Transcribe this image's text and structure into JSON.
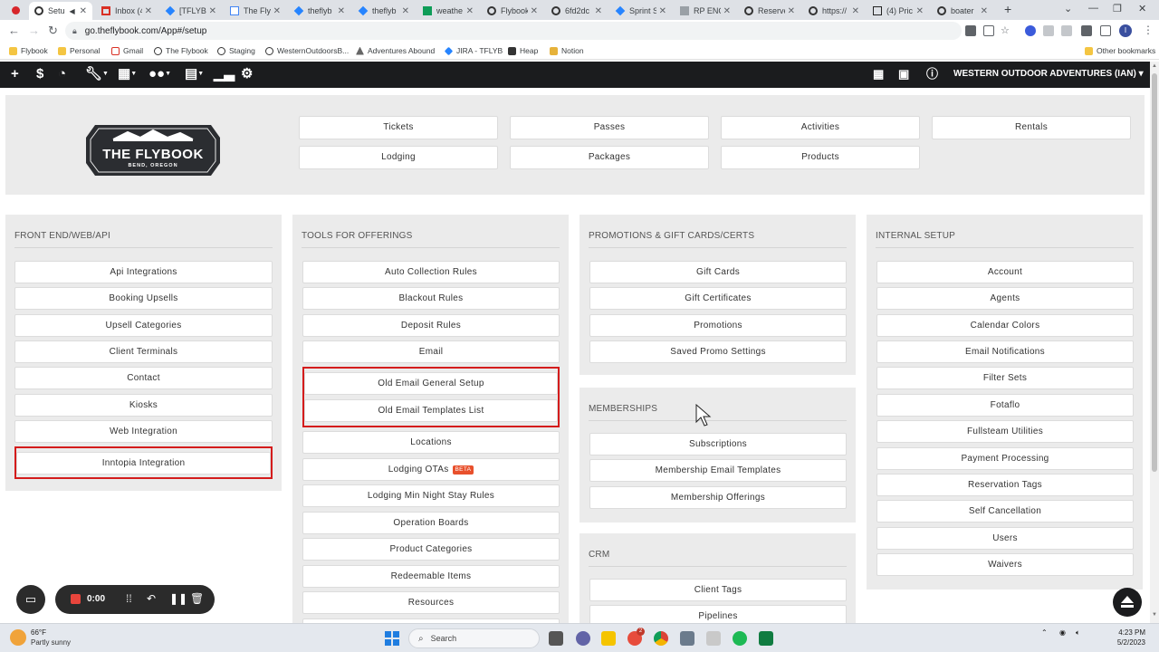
{
  "browser": {
    "tabs": [
      {
        "title": "Setu",
        "active": true
      },
      {
        "title": "Inbox (4"
      },
      {
        "title": "[TFLYB-"
      },
      {
        "title": "The Flyb"
      },
      {
        "title": "theflyb"
      },
      {
        "title": "theflyb"
      },
      {
        "title": "weathe"
      },
      {
        "title": "Flybook"
      },
      {
        "title": "6fd2dc"
      },
      {
        "title": "Sprint S"
      },
      {
        "title": "RP ENG"
      },
      {
        "title": "Reserve"
      },
      {
        "title": "https://"
      },
      {
        "title": "(4) Pric"
      },
      {
        "title": "boater"
      }
    ],
    "url": "go.theflybook.com/App#/setup",
    "bookmarks": [
      "Flybook",
      "Personal",
      "Gmail",
      "The Flybook",
      "Staging",
      "WesternOutdoorsB...",
      "Adventures Abound",
      "JIRA - TFLYB",
      "Heap",
      "Notion"
    ],
    "other_bookmarks": "Other bookmarks",
    "profile_initial": "I"
  },
  "app": {
    "account": "WESTERN OUTDOOR ADVENTURES (IAN)",
    "logo": {
      "name": "THE FLYBOOK",
      "location": "BEND, OREGON"
    },
    "offerings": [
      "Tickets",
      "Passes",
      "Activities",
      "Rentals",
      "Lodging",
      "Packages",
      "Products"
    ],
    "sections": {
      "front_end": {
        "title": "FRONT END/WEB/API",
        "items": [
          "Api Integrations",
          "Booking Upsells",
          "Upsell Categories",
          "Client Terminals",
          "Contact",
          "Kiosks",
          "Web Integration",
          "Inntopia Integration"
        ]
      },
      "tools": {
        "title": "TOOLS FOR OFFERINGS",
        "items": [
          "Auto Collection Rules",
          "Blackout Rules",
          "Deposit Rules",
          "Email",
          "Old Email General Setup",
          "Old Email Templates List",
          "Locations",
          "Lodging OTAs",
          "Lodging Min Night Stay Rules",
          "Operation Boards",
          "Product Categories",
          "Redeemable Items",
          "Resources"
        ],
        "beta_label": "BETA"
      },
      "promotions": {
        "title": "PROMOTIONS & GIFT CARDS/CERTS",
        "items": [
          "Gift Cards",
          "Gift Certificates",
          "Promotions",
          "Saved Promo Settings"
        ]
      },
      "memberships": {
        "title": "MEMBERSHIPS",
        "items": [
          "Subscriptions",
          "Membership Email Templates",
          "Membership Offerings"
        ]
      },
      "crm": {
        "title": "CRM",
        "items": [
          "Client Tags",
          "Pipelines"
        ]
      },
      "internal": {
        "title": "INTERNAL SETUP",
        "items": [
          "Account",
          "Agents",
          "Calendar Colors",
          "Email Notifications",
          "Filter Sets",
          "Fotaflo",
          "Fullsteam Utilities",
          "Payment Processing",
          "Reservation Tags",
          "Self Cancellation",
          "Users",
          "Waivers"
        ]
      }
    }
  },
  "recorder": {
    "time": "0:00"
  },
  "taskbar": {
    "weather_temp": "66°F",
    "weather_desc": "Partly sunny",
    "search": "Search",
    "time": "4:23 PM",
    "date": "5/2/2023",
    "badge": "2"
  },
  "colors": {
    "nav_bg": "#1b1c1e",
    "highlight": "#d41c1c",
    "beta": "#e8502c",
    "panel_bg": "#ebebeb"
  }
}
